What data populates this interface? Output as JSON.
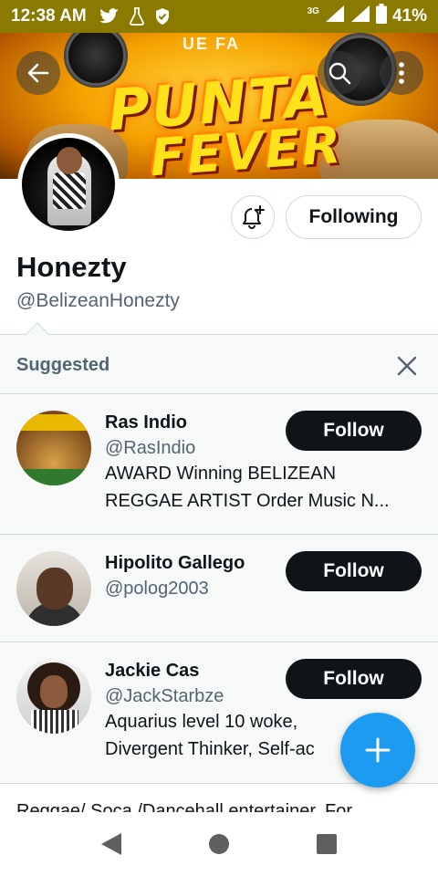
{
  "status_bar": {
    "time": "12:38 AM",
    "network": "3G",
    "battery": "41%",
    "icons": [
      "twitter-bird-icon",
      "flask-icon",
      "shield-icon",
      "signal-icon",
      "battery-icon"
    ]
  },
  "banner": {
    "top_word": "UE FA",
    "title_line1": "PUNTA",
    "title_line2": "FEVER"
  },
  "profile": {
    "name": "Honezty",
    "handle": "@BelizeanHonezty",
    "following_label": "Following"
  },
  "suggested": {
    "header": "Suggested",
    "items": [
      {
        "name": "Ras Indio",
        "handle": "@RasIndio",
        "bio_line1": "AWARD Winning BELIZEAN",
        "bio_line2": "REGGAE ARTIST Order Music N...",
        "follow_label": "Follow"
      },
      {
        "name": "Hipolito Gallego",
        "handle": "@polog2003",
        "follow_label": "Follow"
      },
      {
        "name": "Jackie Cas",
        "handle": "@JackStarbze",
        "bio_line1": "Aquarius level 10 woke,",
        "bio_line2": "Divergent Thinker, Self-ac",
        "follow_label": "Follow"
      }
    ]
  },
  "bio_partial": "Reggae/ Soca /Dancehall entertainer. For",
  "colors": {
    "accent": "#1d9bf0",
    "status_bar": "#8a7a00",
    "follow_bg": "#0f1419"
  }
}
